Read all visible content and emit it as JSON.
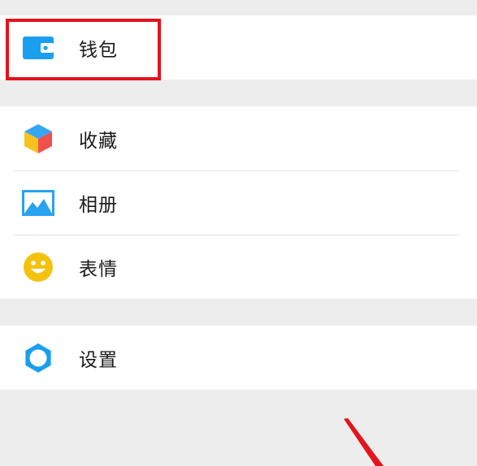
{
  "menu": {
    "wallet": {
      "label": "钱包",
      "icon": "wallet-icon",
      "color": "#1a9ef0"
    },
    "favorites": {
      "label": "收藏",
      "icon": "cube-icon"
    },
    "album": {
      "label": "相册",
      "icon": "image-icon",
      "color": "#27a3ef"
    },
    "stickers": {
      "label": "表情",
      "icon": "smiley-icon",
      "color": "#f4c20d"
    },
    "settings": {
      "label": "设置",
      "icon": "gear-icon",
      "color": "#1a9ef0"
    }
  },
  "colors": {
    "background": "#ededed",
    "highlight_box": "#e4131c",
    "arrow": "#e4131c"
  }
}
